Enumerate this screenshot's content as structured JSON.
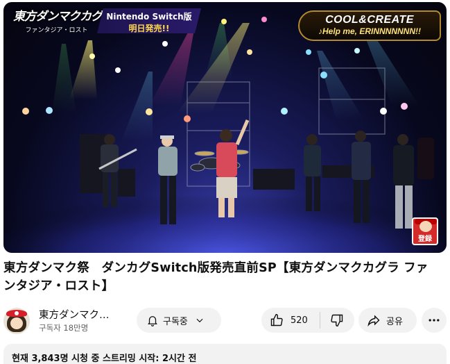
{
  "video": {
    "overlay": {
      "logo_title": "東方ダンマクカグラ",
      "logo_subtitle": "ファンタジア・ロスト",
      "switch_banner_line1": "Nintendo Switch版",
      "switch_banner_line2": "明日発売!!",
      "artist_line1": "COOL&CREATE",
      "artist_line2": "♪Help me, ERINNNNNNN!!",
      "watermark_label": "登録"
    }
  },
  "title": "東方ダンマク祭　ダンカグSwitch版発売直前SP【東方ダンマクカグラ ファンタジア・ロスト】",
  "channel": {
    "name": "東方ダンマク…",
    "subscribers": "구독자 18만명",
    "avatar_icon": "reimu-avatar-icon"
  },
  "actions": {
    "subscribe_label": "구독중",
    "subscribe_icons": [
      "bell-icon",
      "chevron-down-icon"
    ],
    "like_count": "520",
    "like_icon": "thumbs-up-icon",
    "dislike_icon": "thumbs-down-icon",
    "share_label": "공유",
    "share_icon": "share-arrow-icon",
    "more_icon": "more-horizontal-icon"
  },
  "description": {
    "live_info": "현재 3,843명 시청 중 스트리밍 시작: 2시간 전"
  },
  "colors": {
    "pill_bg": "#f2f2f2",
    "text_primary": "#0f0f0f",
    "text_secondary": "#606060",
    "banner_gold": "#b38a2d"
  }
}
